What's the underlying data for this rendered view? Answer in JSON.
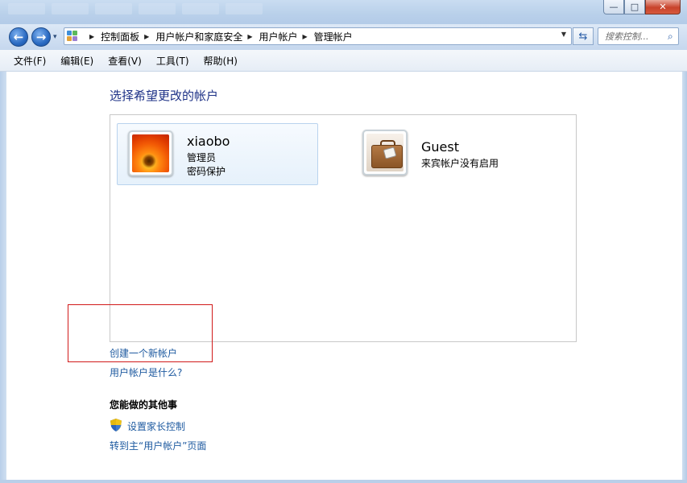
{
  "window": {
    "minimize": "—",
    "maximize": "□",
    "close": "✕"
  },
  "nav": {
    "back_glyph": "←",
    "forward_glyph": "→",
    "recent_glyph": "▾",
    "breadcrumb": [
      "控制面板",
      "用户帐户和家庭安全",
      "用户帐户",
      "管理帐户"
    ],
    "crumb_separator": "▶",
    "dropdown_glyph": "▼",
    "refresh_glyph": "⇆",
    "search_placeholder": "搜索控制...",
    "search_glyph": "⌕"
  },
  "menu": [
    "文件(F)",
    "编辑(E)",
    "查看(V)",
    "工具(T)",
    "帮助(H)"
  ],
  "main": {
    "heading": "选择希望更改的帐户",
    "accounts": [
      {
        "name": "xiaobo",
        "line1": "管理员",
        "line2": "密码保护",
        "icon": "flower-avatar-icon"
      },
      {
        "name": "Guest",
        "line1": "来宾帐户没有启用",
        "icon": "suitcase-avatar-icon"
      }
    ],
    "links": {
      "create": "创建一个新帐户",
      "what": "用户帐户是什么?"
    },
    "other_title": "您能做的其他事",
    "other_links": {
      "parental": "设置家长控制",
      "main_page": "转到主“用户帐户”页面"
    }
  },
  "colors": {
    "link": "#1e5aa0",
    "heading": "#1e3287",
    "annotation": "#d11a1a"
  }
}
